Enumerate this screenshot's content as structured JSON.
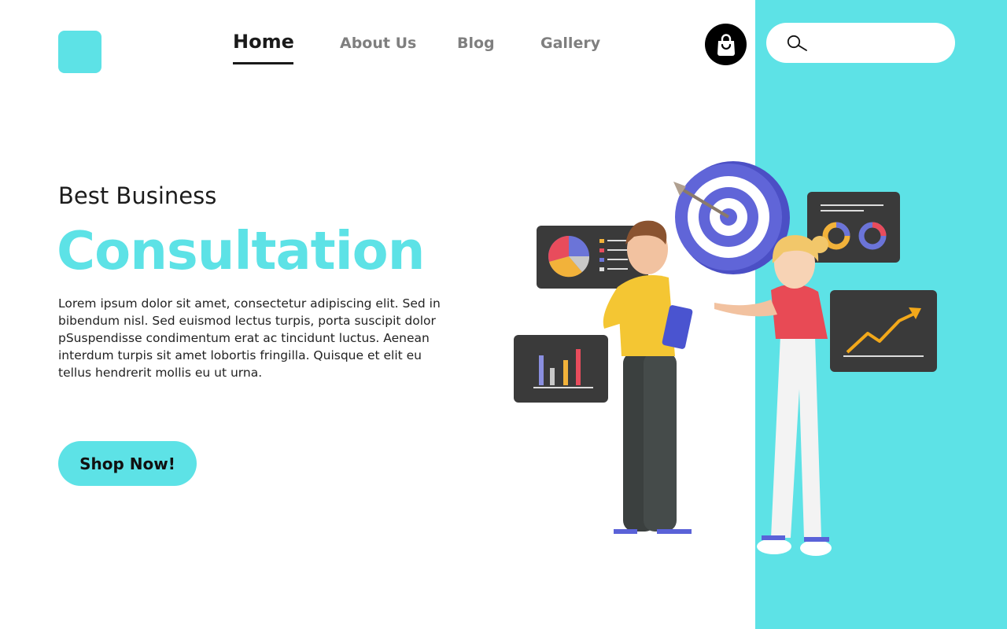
{
  "nav": {
    "items": [
      {
        "label": "Home",
        "active": true
      },
      {
        "label": "About Us",
        "active": false
      },
      {
        "label": "Blog",
        "active": false
      },
      {
        "label": "Gallery",
        "active": false
      }
    ]
  },
  "icons": {
    "cart": "shopping-bag-icon",
    "search": "search-icon"
  },
  "search": {
    "value": "",
    "placeholder": ""
  },
  "hero": {
    "subtitle": "Best Business",
    "headline": "Consultation",
    "body": "Lorem ipsum dolor sit amet, consectetur adipiscing elit. Sed in bibendum nisl. Sed euismod lectus turpis, porta suscipit dolor pSuspendisse condimentum erat ac tincidunt luctus. Aenean interdum turpis sit amet lobortis fringilla. Quisque et elit eu tellus hendrerit mollis eu ut urna.",
    "cta_label": "Shop Now!"
  },
  "colors": {
    "accent": "#5de2e6",
    "text_dark": "#1c1c1c",
    "nav_inactive": "#7f7f7f",
    "button_dark": "#000000"
  }
}
